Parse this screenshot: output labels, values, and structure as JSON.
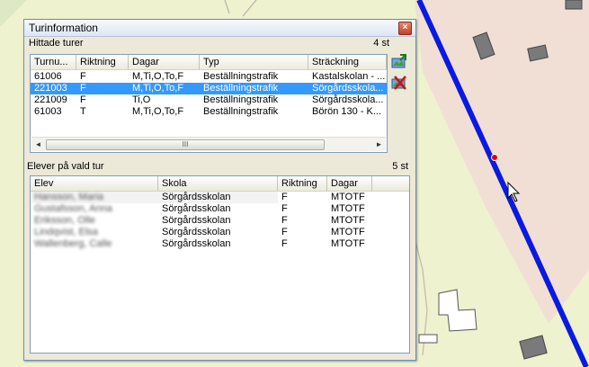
{
  "window": {
    "title": "Turinformation",
    "close_icon": "close-icon"
  },
  "found_tours": {
    "label": "Hittade turer",
    "count": "4 st",
    "columns": [
      "Turnu...",
      "Riktning",
      "Dagar",
      "Typ",
      "Sträckning"
    ],
    "rows": [
      {
        "turnr": "61006",
        "riktning": "F",
        "dagar": "M,Ti,O,To,F",
        "typ": "Beställningstrafik",
        "strackning": "Kastalskolan - ..."
      },
      {
        "turnr": "221003",
        "riktning": "F",
        "dagar": "M,Ti,O,To,F",
        "typ": "Beställningstrafik",
        "strackning": "Sörgårdsskola..."
      },
      {
        "turnr": "221009",
        "riktning": "F",
        "dagar": "Ti,O",
        "typ": "Beställningstrafik",
        "strackning": "Sörgårdsskola..."
      },
      {
        "turnr": "61003",
        "riktning": "T",
        "dagar": "M,Ti,O,To,F",
        "typ": "Beställningstrafik",
        "strackning": "Börön 130 - K..."
      }
    ],
    "selected_row": 1,
    "scroll_left": "◄",
    "scroll_right": "►",
    "scroll_thumb": "III"
  },
  "side_buttons": [
    {
      "icon": "add-to-map-icon"
    },
    {
      "icon": "remove-from-map-icon"
    }
  ],
  "students": {
    "label": "Elever på vald tur",
    "count": "5 st",
    "columns": [
      "Elev",
      "Skola",
      "Riktning",
      "Dagar"
    ],
    "rows": [
      {
        "elev": "Hansson, Maria",
        "skola": "Sörgårdsskolan",
        "riktning": "F",
        "dagar": "MTOTF"
      },
      {
        "elev": "Gustafsson, Anna",
        "skola": "Sörgårdsskolan",
        "riktning": "F",
        "dagar": "MTOTF"
      },
      {
        "elev": "Eriksson, Olle",
        "skola": "Sörgårdsskolan",
        "riktning": "F",
        "dagar": "MTOTF"
      },
      {
        "elev": "Lindqvist, Elsa",
        "skola": "Sörgårdsskolan",
        "riktning": "F",
        "dagar": "MTOTF"
      },
      {
        "elev": "Wallenberg, Calle",
        "skola": "Sörgårdsskolan",
        "riktning": "F",
        "dagar": "MTOTF"
      }
    ]
  },
  "colors": {
    "route": "#0a1adf",
    "selection": "#3399ff",
    "map_field": "#eef2cf",
    "map_zone": "#f1dfd6",
    "building": "#7a7a7a"
  }
}
